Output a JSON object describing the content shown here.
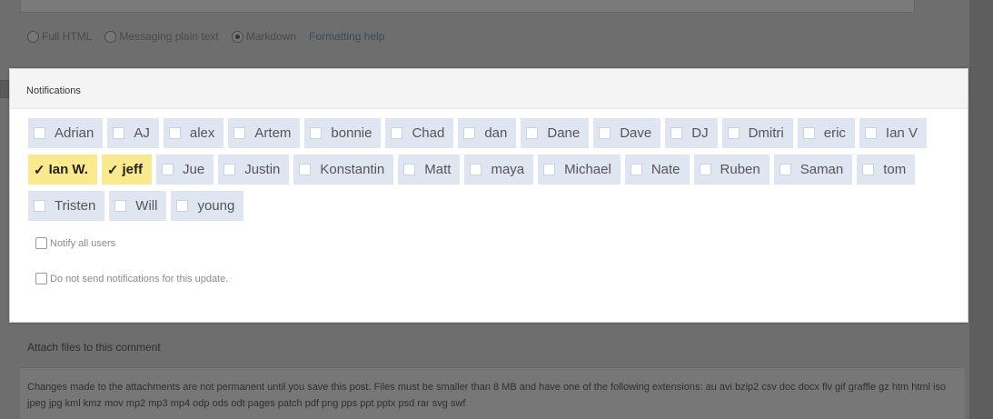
{
  "format": {
    "options": [
      {
        "label": "Full HTML",
        "selected": false
      },
      {
        "label": "Messaging plain text",
        "selected": false
      },
      {
        "label": "Markdown",
        "selected": true
      }
    ],
    "help_link": "Formatting help"
  },
  "notifications": {
    "title": "Notifications",
    "users": [
      {
        "name": "Adrian",
        "checked": false
      },
      {
        "name": "AJ",
        "checked": false
      },
      {
        "name": "alex",
        "checked": false
      },
      {
        "name": "Artem",
        "checked": false
      },
      {
        "name": "bonnie",
        "checked": false
      },
      {
        "name": "Chad",
        "checked": false
      },
      {
        "name": "dan",
        "checked": false
      },
      {
        "name": "Dane",
        "checked": false
      },
      {
        "name": "Dave",
        "checked": false
      },
      {
        "name": "DJ",
        "checked": false
      },
      {
        "name": "Dmitri",
        "checked": false
      },
      {
        "name": "eric",
        "checked": false
      },
      {
        "name": "Ian V",
        "checked": false
      },
      {
        "name": "Ian W.",
        "checked": true
      },
      {
        "name": "jeff",
        "checked": true
      },
      {
        "name": "Jue",
        "checked": false
      },
      {
        "name": "Justin",
        "checked": false
      },
      {
        "name": "Konstantin",
        "checked": false
      },
      {
        "name": "Matt",
        "checked": false
      },
      {
        "name": "maya",
        "checked": false
      },
      {
        "name": "Michael",
        "checked": false
      },
      {
        "name": "Nate",
        "checked": false
      },
      {
        "name": "Ruben",
        "checked": false
      },
      {
        "name": "Saman",
        "checked": false
      },
      {
        "name": "tom",
        "checked": false
      },
      {
        "name": "Tristen",
        "checked": false
      },
      {
        "name": "Will",
        "checked": false
      },
      {
        "name": "young",
        "checked": false
      }
    ],
    "notify_all_label": "Notify all users",
    "no_send_label": "Do not send notifications for this update."
  },
  "attachments": {
    "title": "Attach files to this comment",
    "text": "Changes made to the attachments are not permanent until you save this post. Files must be smaller than 8 MB and have one of the following extensions: au avi bzip2 csv doc docx flv gif graffle gz htm html iso jpeg jpg kml kmz mov mp2 mp3 mp4 odp ods odt pages patch pdf png pps ppt pptx psd rar svg swf"
  },
  "colors": {
    "checked_bg": "#fbe98d",
    "unchecked_bg": "#dfe6f1"
  }
}
